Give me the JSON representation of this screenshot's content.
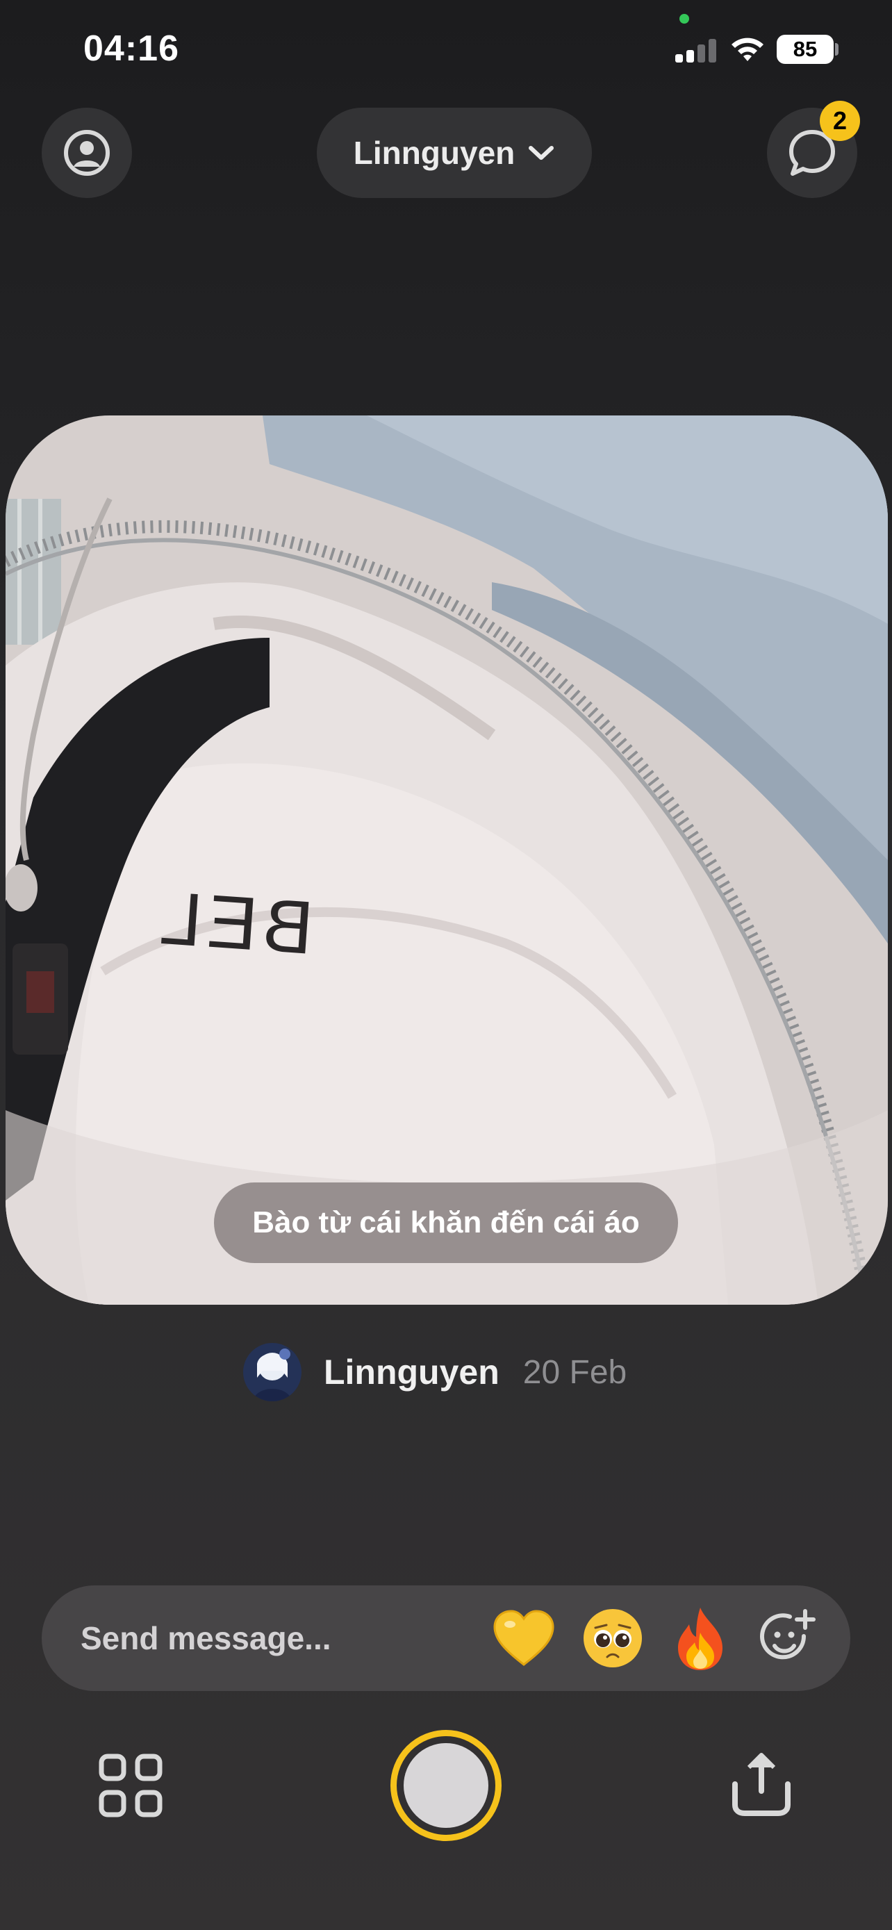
{
  "status_bar": {
    "time": "04:16",
    "battery_level": "85",
    "icons": [
      "cellular-signal-icon",
      "wifi-icon",
      "battery-icon"
    ]
  },
  "header": {
    "friend_selector_label": "Linnguyen",
    "profile_icon": "profile-icon",
    "chat_icon": "chat-bubble-icon",
    "chat_badge_count": "2"
  },
  "post": {
    "caption": "Bào từ cái khăn đến cái áo",
    "photo_text": "BEL",
    "author_name": "Linnguyen",
    "date": "20 Feb"
  },
  "message_bar": {
    "placeholder": "Send message...",
    "reactions": [
      {
        "name": "yellow-heart",
        "glyph": "💛"
      },
      {
        "name": "pleading-face",
        "glyph": "🥺"
      },
      {
        "name": "fire",
        "glyph": "🔥"
      }
    ],
    "add_reaction_icon": "add-emoji-icon"
  },
  "bottom_bar": {
    "grid_icon": "grid-icon",
    "shutter": "capture-button",
    "share_icon": "share-icon"
  },
  "colors": {
    "accent": "#f6c21b",
    "background": "#1c1c1e",
    "pill": "#333335",
    "message_bar": "#474547"
  }
}
